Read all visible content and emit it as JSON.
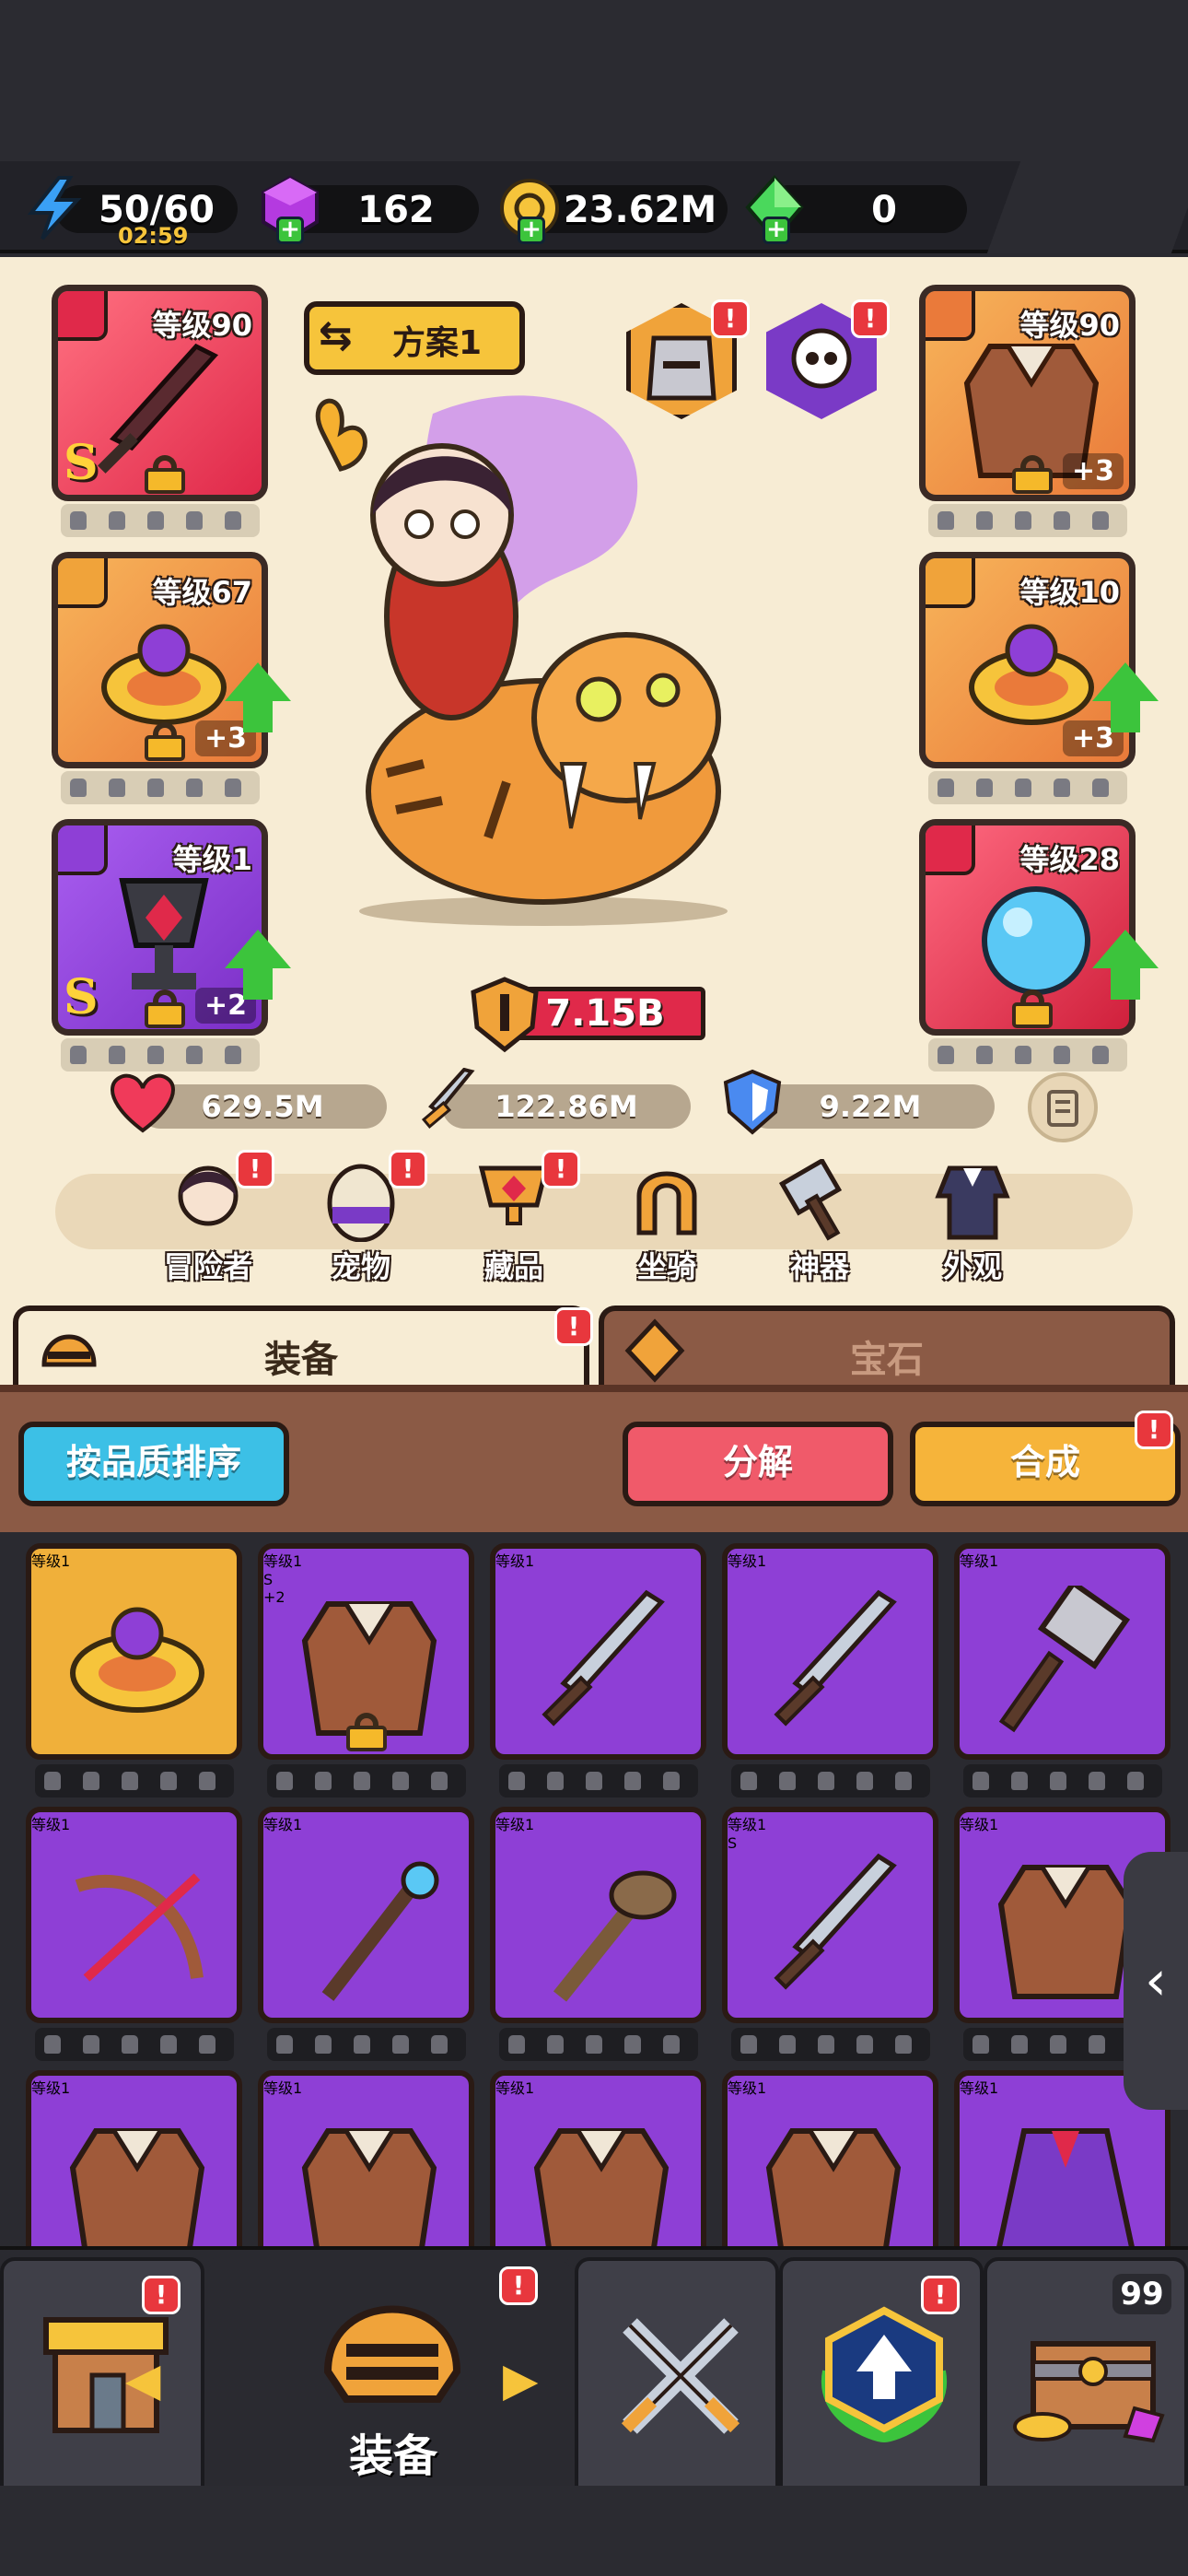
{
  "resources": {
    "energy": "50/60",
    "energy_timer": "02:59",
    "gems": "162",
    "coins": "23.62M",
    "green_gems": "0"
  },
  "hero": {
    "loadout": "方案1",
    "power": "7.15B",
    "hp": "629.5M",
    "attack": "122.86M",
    "defense": "9.22M"
  },
  "equipped": {
    "left": [
      {
        "level": "等级90",
        "grade": "S",
        "plus": ""
      },
      {
        "level": "等级67",
        "grade": "",
        "plus": "+3"
      },
      {
        "level": "等级1",
        "grade": "S",
        "plus": "+2"
      }
    ],
    "right": [
      {
        "level": "等级90",
        "grade": "",
        "plus": "+3"
      },
      {
        "level": "等级10",
        "grade": "",
        "plus": "+3"
      },
      {
        "level": "等级28",
        "grade": "",
        "plus": ""
      }
    ]
  },
  "menu": {
    "adventurer": "冒险者",
    "pet": "宠物",
    "collection": "藏品",
    "mount": "坐骑",
    "artifact": "神器",
    "appearance": "外观"
  },
  "tabs": {
    "equipment": "装备",
    "gems": "宝石"
  },
  "toolbar": {
    "sort": "按品质排序",
    "decompose": "分解",
    "synthesize": "合成"
  },
  "inventory": [
    {
      "level": "等级1",
      "grade": "",
      "plus": "",
      "color": "#f0b03a",
      "icon": "ring-icon"
    },
    {
      "level": "等级1",
      "grade": "S",
      "plus": "+2",
      "color": "#8e3fd6",
      "icon": "armor-icon"
    },
    {
      "level": "等级1",
      "grade": "",
      "plus": "",
      "color": "#8e3fd6",
      "icon": "sword-icon"
    },
    {
      "level": "等级1",
      "grade": "",
      "plus": "",
      "color": "#8e3fd6",
      "icon": "sword-icon"
    },
    {
      "level": "等级1",
      "grade": "",
      "plus": "",
      "color": "#8e3fd6",
      "icon": "hammer-icon"
    },
    {
      "level": "等级1",
      "grade": "",
      "plus": "",
      "color": "#8e3fd6",
      "icon": "crossbow-icon"
    },
    {
      "level": "等级1",
      "grade": "",
      "plus": "",
      "color": "#8e3fd6",
      "icon": "staff-icon"
    },
    {
      "level": "等级1",
      "grade": "",
      "plus": "",
      "color": "#8e3fd6",
      "icon": "club-icon"
    },
    {
      "level": "等级1",
      "grade": "S",
      "plus": "",
      "color": "#8e3fd6",
      "icon": "sword-icon"
    },
    {
      "level": "等级1",
      "grade": "",
      "plus": "",
      "color": "#8e3fd6",
      "icon": "armor-icon"
    },
    {
      "level": "等级1",
      "grade": "",
      "plus": "",
      "color": "#8e3fd6",
      "icon": "armor-icon"
    },
    {
      "level": "等级1",
      "grade": "",
      "plus": "",
      "color": "#8e3fd6",
      "icon": "armor-icon"
    },
    {
      "level": "等级1",
      "grade": "",
      "plus": "",
      "color": "#8e3fd6",
      "icon": "armor-icon"
    },
    {
      "level": "等级1",
      "grade": "",
      "plus": "",
      "color": "#8e3fd6",
      "icon": "armor-icon"
    },
    {
      "level": "等级1",
      "grade": "",
      "plus": "",
      "color": "#8e3fd6",
      "icon": "cloak-icon"
    }
  ],
  "nav": {
    "active_label": "装备",
    "chest_count": "99"
  },
  "colors": {
    "gold": "#f6c43b",
    "purple": "#8e3fd6",
    "red": "#e0294a",
    "orange": "#f0a33a",
    "green": "#3cc43c",
    "badge": "#e8373d"
  }
}
